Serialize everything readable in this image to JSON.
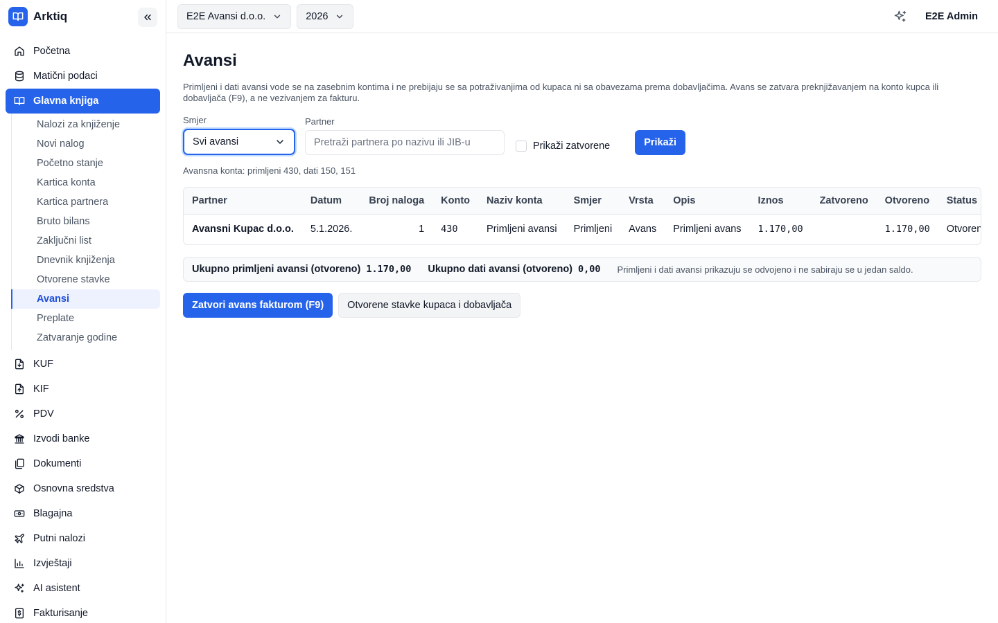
{
  "app": {
    "name": "Arktiq"
  },
  "sidebar": {
    "items": [
      {
        "label": "Početna",
        "icon": "home-icon"
      },
      {
        "label": "Matični podaci",
        "icon": "database-icon"
      },
      {
        "label": "Glavna knjiga",
        "icon": "book-icon",
        "active": true
      }
    ],
    "sub_items": [
      {
        "label": "Nalozi za knjiženje"
      },
      {
        "label": "Novi nalog"
      },
      {
        "label": "Početno stanje"
      },
      {
        "label": "Kartica konta"
      },
      {
        "label": "Kartica partnera"
      },
      {
        "label": "Bruto bilans"
      },
      {
        "label": "Zaključni list"
      },
      {
        "label": "Dnevnik knjiženja"
      },
      {
        "label": "Otvorene stavke"
      },
      {
        "label": "Avansi",
        "active": true
      },
      {
        "label": "Preplate"
      },
      {
        "label": "Zatvaranje godine"
      }
    ],
    "items_after": [
      {
        "label": "KUF",
        "icon": "file-in-icon"
      },
      {
        "label": "KIF",
        "icon": "file-out-icon"
      },
      {
        "label": "PDV",
        "icon": "percent-icon"
      },
      {
        "label": "Izvodi banke",
        "icon": "bank-icon"
      },
      {
        "label": "Dokumenti",
        "icon": "documents-icon"
      },
      {
        "label": "Osnovna sredstva",
        "icon": "box-icon"
      },
      {
        "label": "Blagajna",
        "icon": "cash-icon"
      },
      {
        "label": "Putni nalozi",
        "icon": "plane-icon"
      },
      {
        "label": "Izvještaji",
        "icon": "chart-icon"
      },
      {
        "label": "AI asistent",
        "icon": "sparkles-icon"
      },
      {
        "label": "Fakturisanje",
        "icon": "invoice-icon"
      }
    ]
  },
  "topbar": {
    "company": "E2E Avansi d.o.o.",
    "year": "2026",
    "user": "E2E Admin"
  },
  "page": {
    "title": "Avansi",
    "description": "Primljeni i dati avansi vode se na zasebnim kontima i ne prebijaju se sa potraživanjima od kupaca ni sa obavezama prema dobavljačima. Avans se zatvara preknjižavanjem na konto kupca ili dobavljača (F9), a ne vezivanjem za fakturu."
  },
  "filters": {
    "direction_label": "Smjer",
    "direction_value": "Svi avansi",
    "partner_label": "Partner",
    "partner_placeholder": "Pretraži partnera po nazivu ili JIB-u",
    "show_closed_label": "Prikaži zatvorene",
    "show_button": "Prikaži"
  },
  "hint": "Avansna konta: primljeni 430, dati 150, 151",
  "table": {
    "columns": [
      "Partner",
      "Datum",
      "Broj naloga",
      "Konto",
      "Naziv konta",
      "Smjer",
      "Vrsta",
      "Opis",
      "Iznos",
      "Zatvoreno",
      "Otvoreno",
      "Status"
    ],
    "rows": [
      {
        "partner": "Avansni Kupac d.o.o.",
        "date": "5.1.2026.",
        "order_no": "1",
        "account": "430",
        "account_name": "Primljeni avansi",
        "direction": "Primljeni",
        "type": "Avans",
        "description": "Primljeni avans",
        "amount": "1.170,00",
        "closed": "",
        "open": "1.170,00",
        "status": "Otvoren"
      }
    ]
  },
  "summary": {
    "received_label": "Ukupno primljeni avansi (otvoreno)",
    "received_value": "1.170,00",
    "given_label": "Ukupno dati avansi (otvoreno)",
    "given_value": "0,00",
    "note": "Primljeni i dati avansi prikazuju se odvojeno i ne sabiraju se u jedan saldo."
  },
  "actions": {
    "close_button": "Zatvori avans fakturom (F9)",
    "open_items_button": "Otvorene stavke kupaca i dobavljača"
  },
  "colors": {
    "accent": "#2563eb",
    "active_sub_bg": "#eef2ff"
  }
}
